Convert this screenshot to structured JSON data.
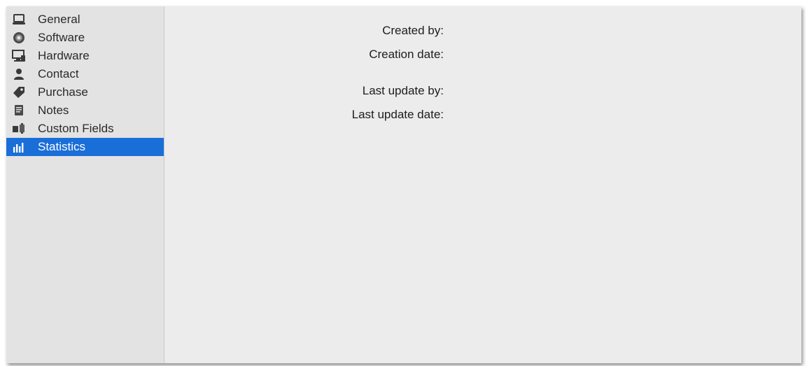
{
  "sidebar": {
    "items": [
      {
        "label": "General",
        "icon": "laptop-icon"
      },
      {
        "label": "Software",
        "icon": "disc-icon"
      },
      {
        "label": "Hardware",
        "icon": "hardware-monitor-icon"
      },
      {
        "label": "Contact",
        "icon": "person-icon"
      },
      {
        "label": "Purchase",
        "icon": "price-tag-icon"
      },
      {
        "label": "Notes",
        "icon": "notepad-icon"
      },
      {
        "label": "Custom Fields",
        "icon": "custom-fields-icon"
      },
      {
        "label": "Statistics",
        "icon": "bar-chart-icon"
      }
    ],
    "selected_label": "Statistics",
    "selection_color": "#1a6ed8"
  },
  "statistics": {
    "created_by_label": "Created by:",
    "created_by_value": "",
    "creation_date_label": "Creation date:",
    "creation_date_value": "",
    "last_update_by_label": "Last update by:",
    "last_update_by_value": "",
    "last_update_date_label": "Last update date:",
    "last_update_date_value": ""
  }
}
